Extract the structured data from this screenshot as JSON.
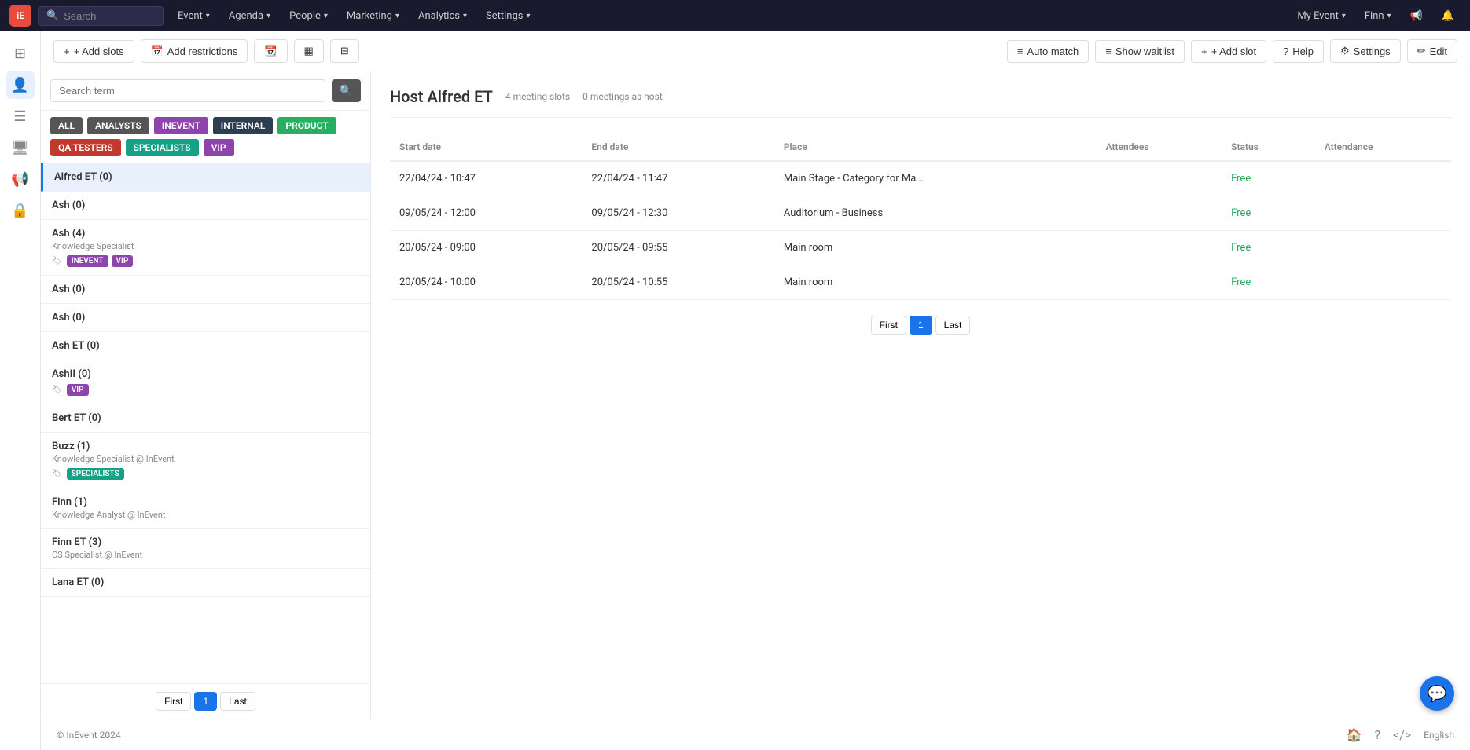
{
  "app": {
    "logo": "iE",
    "copyright": "© InEvent 2024",
    "language": "English"
  },
  "nav": {
    "search_placeholder": "Search",
    "items": [
      {
        "id": "event",
        "label": "Event",
        "has_dropdown": true
      },
      {
        "id": "agenda",
        "label": "Agenda",
        "has_dropdown": true
      },
      {
        "id": "people",
        "label": "People",
        "has_dropdown": true
      },
      {
        "id": "marketing",
        "label": "Marketing",
        "has_dropdown": true
      },
      {
        "id": "analytics",
        "label": "Analytics",
        "has_dropdown": true
      },
      {
        "id": "settings",
        "label": "Settings",
        "has_dropdown": true
      }
    ],
    "right": {
      "my_event": "My Event",
      "user": "Finn"
    }
  },
  "toolbar": {
    "add_slots": "+ Add slots",
    "add_restrictions": "Add restrictions",
    "auto_match": "Auto match",
    "show_waitlist": "Show waitlist",
    "add_slot": "+ Add slot",
    "help": "Help",
    "settings": "Settings",
    "edit": "Edit"
  },
  "search": {
    "placeholder": "Search term"
  },
  "filter_tags": [
    {
      "id": "all",
      "label": "ALL",
      "class": "tag-all"
    },
    {
      "id": "analysts",
      "label": "ANALYSTS",
      "class": "tag-analysts"
    },
    {
      "id": "inevent",
      "label": "INEVENT",
      "class": "tag-inevent"
    },
    {
      "id": "internal",
      "label": "INTERNAL",
      "class": "tag-internal"
    },
    {
      "id": "product",
      "label": "PRODUCT",
      "class": "tag-product"
    },
    {
      "id": "qatesters",
      "label": "QA TESTERS",
      "class": "tag-qatesters"
    },
    {
      "id": "specialists",
      "label": "SPECIALISTS",
      "class": "tag-specialists"
    },
    {
      "id": "vip",
      "label": "VIP",
      "class": "tag-vip"
    }
  ],
  "people_list": [
    {
      "id": "alfred-et",
      "name": "Alfred ET (0)",
      "role": "",
      "tags": [],
      "active": true
    },
    {
      "id": "ash-0a",
      "name": "Ash (0)",
      "role": "",
      "tags": []
    },
    {
      "id": "ash-4",
      "name": "Ash (4)",
      "role": "Knowledge Specialist",
      "tags": [
        {
          "label": "INEVENT",
          "class": "mt-inevent"
        },
        {
          "label": "VIP",
          "class": "mt-vip"
        }
      ]
    },
    {
      "id": "ash-0b",
      "name": "Ash (0)",
      "role": "",
      "tags": []
    },
    {
      "id": "ash-0c",
      "name": "Ash (0)",
      "role": "",
      "tags": []
    },
    {
      "id": "ash-et",
      "name": "Ash ET (0)",
      "role": "",
      "tags": []
    },
    {
      "id": "ashll",
      "name": "AshII (0)",
      "role": "",
      "tags": [
        {
          "label": "VIP",
          "class": "mt-vip"
        }
      ]
    },
    {
      "id": "bert-et",
      "name": "Bert ET (0)",
      "role": "",
      "tags": []
    },
    {
      "id": "buzz-1",
      "name": "Buzz (1)",
      "role": "Knowledge Specialist @ InEvent",
      "tags": [
        {
          "label": "SPECIALISTS",
          "class": "mt-specialists"
        }
      ]
    },
    {
      "id": "finn-1",
      "name": "Finn (1)",
      "role": "Knowledge Analyst @ InEvent",
      "tags": []
    },
    {
      "id": "finn-et-3",
      "name": "Finn ET (3)",
      "role": "CS Specialist @ InEvent",
      "tags": []
    },
    {
      "id": "lana-et",
      "name": "Lana ET (0)",
      "role": "",
      "tags": []
    }
  ],
  "list_pagination": {
    "first": "First",
    "page": "1",
    "last": "Last"
  },
  "host": {
    "title": "Host Alfred ET",
    "meeting_slots": "4 meeting slots",
    "meetings_as_host": "0 meetings as host"
  },
  "table": {
    "columns": [
      "Start date",
      "End date",
      "Place",
      "Attendees",
      "Status",
      "Attendance"
    ],
    "rows": [
      {
        "start": "22/04/24 - 10:47",
        "end": "22/04/24 - 11:47",
        "place": "Main Stage - Category for Ma...",
        "attendees": "",
        "status": "Free",
        "attendance": ""
      },
      {
        "start": "09/05/24 - 12:00",
        "end": "09/05/24 - 12:30",
        "place": "Auditorium - Business",
        "attendees": "",
        "status": "Free",
        "attendance": ""
      },
      {
        "start": "20/05/24 - 09:00",
        "end": "20/05/24 - 09:55",
        "place": "Main room",
        "attendees": "",
        "status": "Free",
        "attendance": ""
      },
      {
        "start": "20/05/24 - 10:00",
        "end": "20/05/24 - 10:55",
        "place": "Main room",
        "attendees": "",
        "status": "Free",
        "attendance": ""
      }
    ]
  },
  "main_pagination": {
    "first": "First",
    "page": "1",
    "last": "Last"
  },
  "footer": {
    "copyright": "© InEvent 2024",
    "language": "English"
  }
}
